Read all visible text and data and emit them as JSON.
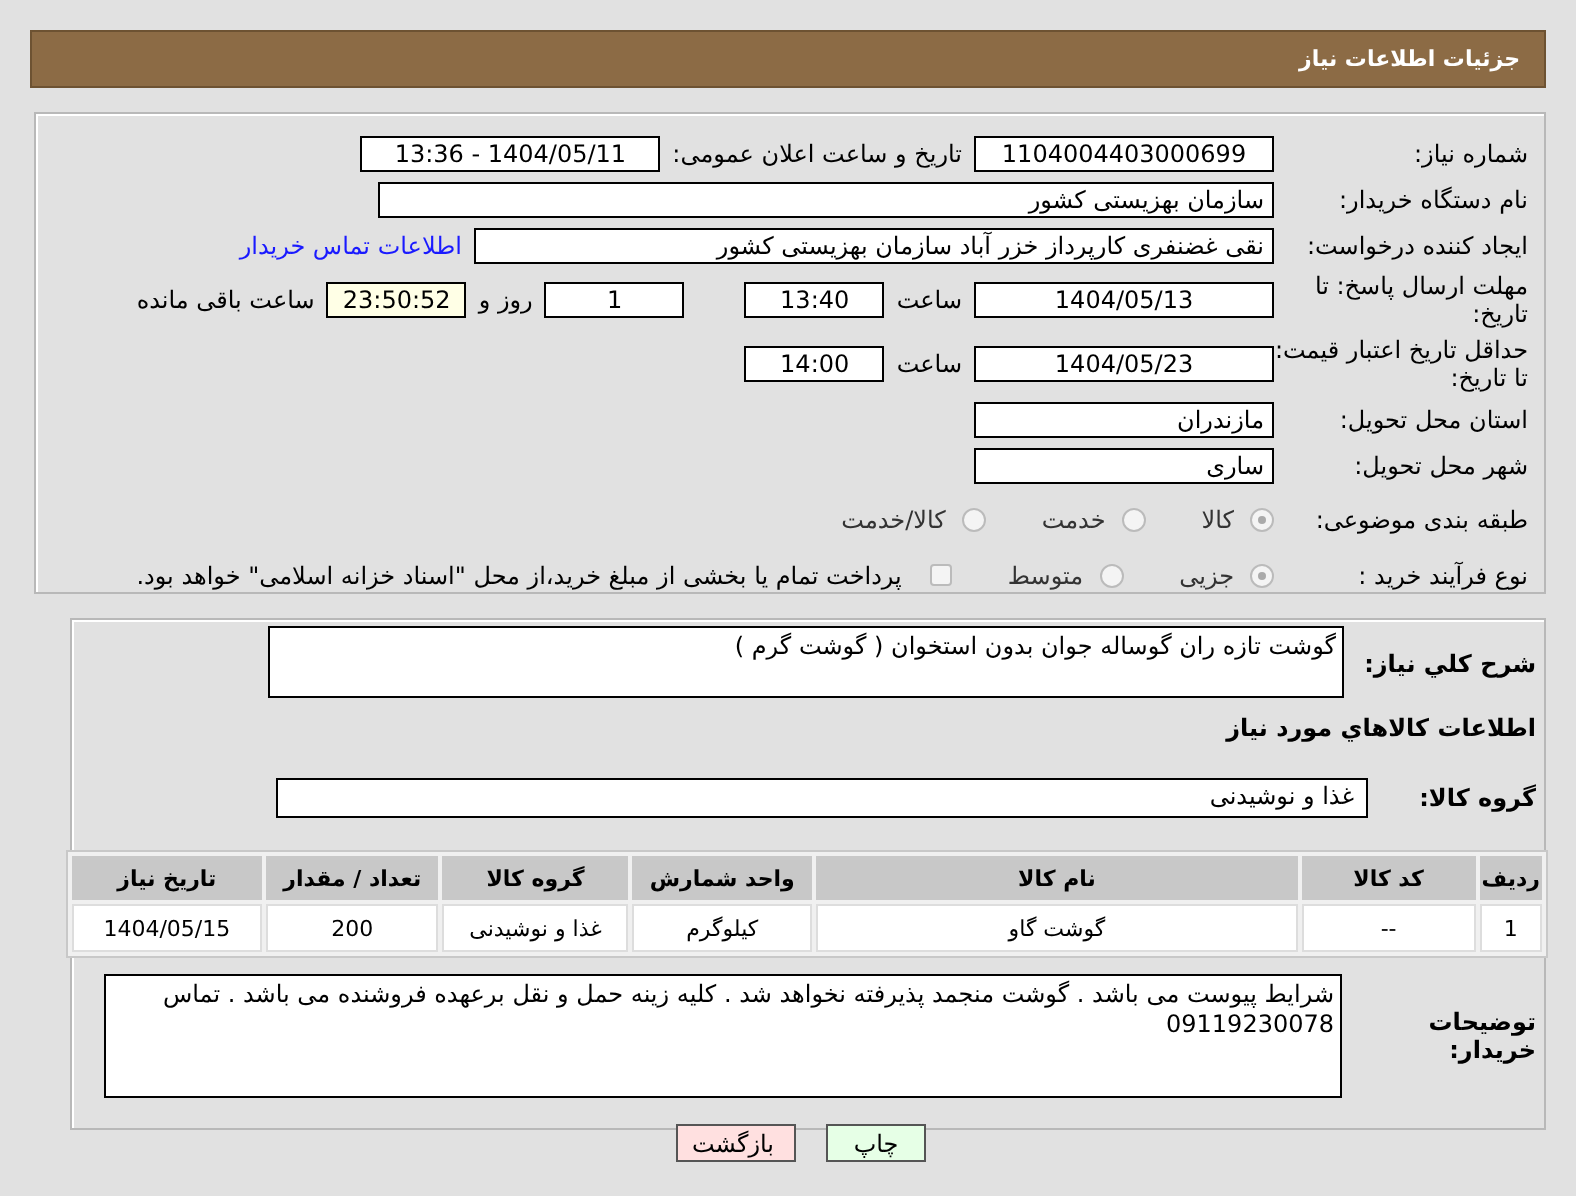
{
  "header": {
    "title": "جزئیات اطلاعات نیاز"
  },
  "need_number": {
    "label": "شماره نیاز:",
    "value": "1104004403000699"
  },
  "announce": {
    "label": "تاریخ و ساعت اعلان عمومی:",
    "value": "1404/05/11 - 13:36"
  },
  "buyer_org": {
    "label": "نام دستگاه خریدار:",
    "value": "سازمان بهزیستی کشور"
  },
  "requester": {
    "label": "ایجاد کننده درخواست:",
    "value": "نقی غضنفری کارپرداز خزر آباد سازمان بهزیستی کشور",
    "link": "اطلاعات تماس خریدار"
  },
  "reply_deadline": {
    "label": "مهلت ارسال پاسخ: تا تاریخ:",
    "date": "1404/05/13",
    "time_label": "ساعت",
    "time": "13:40",
    "days": "1",
    "days_label": "روز و",
    "remaining": "23:50:52",
    "remaining_label": "ساعت باقی مانده"
  },
  "price_validity": {
    "label": "حداقل تاریخ اعتبار قیمت: تا تاریخ:",
    "date": "1404/05/23",
    "time_label": "ساعت",
    "time": "14:00"
  },
  "province": {
    "label": "استان محل تحویل:",
    "value": "مازندران"
  },
  "city": {
    "label": "شهر محل تحویل:",
    "value": "ساری"
  },
  "category": {
    "label": "طبقه بندی موضوعی:",
    "options": [
      {
        "label": "کالا",
        "selected": true
      },
      {
        "label": "خدمت",
        "selected": false
      },
      {
        "label": "کالا/خدمت",
        "selected": false
      }
    ]
  },
  "process": {
    "label": "نوع فرآیند خرید :",
    "options": [
      {
        "label": "جزیی",
        "selected": true
      },
      {
        "label": "متوسط",
        "selected": false
      }
    ],
    "payment": {
      "label": "پرداخت تمام یا بخشی از مبلغ خرید،از محل \"اسناد خزانه اسلامی\" خواهد بود.",
      "checked": false
    }
  },
  "description": {
    "label": "شرح کلي نياز:",
    "value": "گوشت تازه ران گوساله جوان بدون استخوان ( گوشت گرم )"
  },
  "goods_title": "اطلاعات کالاهاي مورد نياز",
  "goods_group": {
    "label": "گروه کالا:",
    "value": "غذا و نوشیدنی"
  },
  "table": {
    "columns": [
      "ردیف",
      "کد کالا",
      "نام کالا",
      "واحد شمارش",
      "گروه کالا",
      "تعداد / مقدار",
      "تاریخ نیاز"
    ],
    "rows": [
      [
        "1",
        "--",
        "گوشت گاو",
        "کیلوگرم",
        "غذا و نوشیدنی",
        "200",
        "1404/05/15"
      ]
    ]
  },
  "buyer_notes": {
    "label": "توضیحات خریدار:",
    "value": "شرایط پیوست می باشد . گوشت منجمد پذیرفته نخواهد شد . کلیه زینه حمل و نقل برعهده فروشنده می باشد . تماس 09119230078"
  },
  "buttons": [
    {
      "label": "چاپ",
      "kind": "print"
    },
    {
      "label": "بازگشت",
      "kind": "back"
    }
  ]
}
